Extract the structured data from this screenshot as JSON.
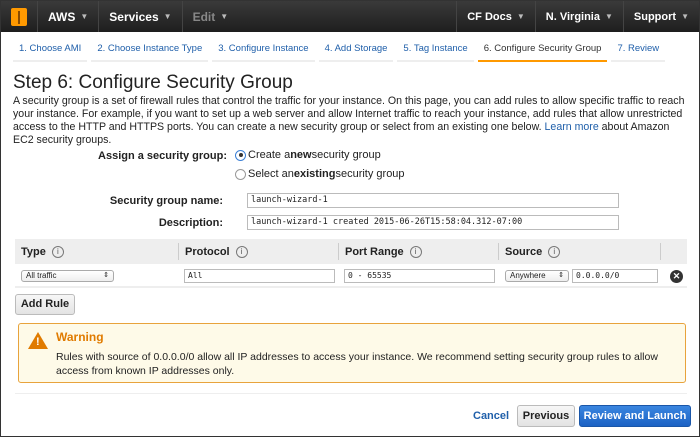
{
  "nav": {
    "brand": "AWS",
    "services": "Services",
    "edit": "Edit",
    "cf_docs": "CF Docs",
    "region": "N. Virginia",
    "support": "Support"
  },
  "steps": [
    {
      "label": "1. Choose AMI"
    },
    {
      "label": "2. Choose Instance Type"
    },
    {
      "label": "3. Configure Instance"
    },
    {
      "label": "4. Add Storage"
    },
    {
      "label": "5. Tag Instance"
    },
    {
      "label": "6. Configure Security Group",
      "active": true
    },
    {
      "label": "7. Review"
    }
  ],
  "page": {
    "title": "Step 6: Configure Security Group",
    "intro": "A security group is a set of firewall rules that control the traffic for your instance. On this page, you can add rules to allow specific traffic to reach your instance. For example, if you want to set up a web server and allow Internet traffic to reach your instance, add rules that allow unrestricted access to the HTTP and HTTPS ports. You can create a new security group or select from an existing one below. ",
    "learn_more": "Learn more",
    "intro_tail": " about Amazon EC2 security groups."
  },
  "form": {
    "assign_label": "Assign a security group:",
    "opt_new_pre": "Create a ",
    "opt_new_bold": "new",
    "opt_new_post": " security group",
    "opt_existing_pre": "Select an ",
    "opt_existing_bold": "existing",
    "opt_existing_post": " security group",
    "selected": "new",
    "name_label": "Security group name:",
    "name_value": "launch-wizard-1",
    "desc_label": "Description:",
    "desc_value": "launch-wizard-1 created 2015-06-26T15:58:04.312-07:00"
  },
  "table": {
    "headers": [
      "Type",
      "Protocol",
      "Port Range",
      "Source"
    ],
    "rows": [
      {
        "type": "All traffic",
        "protocol": "All",
        "port_range": "0 - 65535",
        "source": "Anywhere",
        "cidr": "0.0.0.0/0"
      }
    ]
  },
  "add_rule": "Add Rule",
  "warning": {
    "title": "Warning",
    "message": "Rules with source of 0.0.0.0/0 allow all IP addresses to access your instance. We recommend setting security group rules to allow access from known IP addresses only."
  },
  "footer": {
    "cancel": "Cancel",
    "previous": "Previous",
    "review": "Review and Launch"
  },
  "colors": {
    "accent": "#ff9900",
    "link": "#1f5faa",
    "primary": "#1f6fcf",
    "warning": "#e07b00"
  }
}
